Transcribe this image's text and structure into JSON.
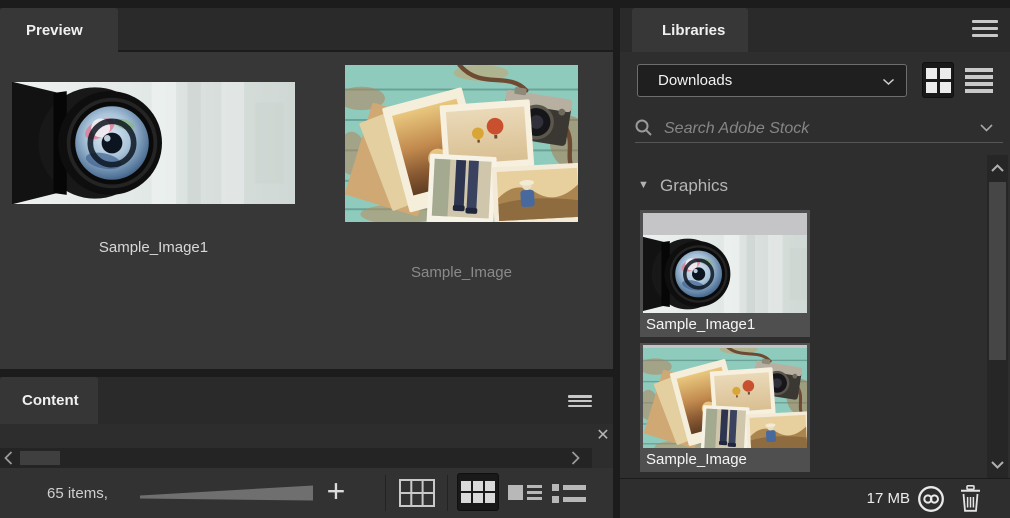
{
  "colors": {
    "canvas_bg": "#1c1c1c",
    "panel_bg": "#373737",
    "libraries_bg": "#2e2e2e",
    "tab_strip_bg": "#2a2a2a",
    "toolbar_bg": "#323232",
    "card_bg": "#4f4f4f",
    "selected_button_bg": "#191919",
    "text_primary": "#f0f0f0",
    "text_muted": "#8a8a8a"
  },
  "preview_panel": {
    "tab_label": "Preview",
    "items": [
      {
        "label": "Sample_Image1",
        "image": "camera-lens-photo"
      },
      {
        "label": "Sample_Image",
        "image": "vintage-photo-collage"
      }
    ]
  },
  "content_panel": {
    "tab_label": "Content",
    "items_count": "65 items,"
  },
  "libraries_panel": {
    "tab_label": "Libraries",
    "folder_dropdown_value": "Downloads",
    "search_placeholder": "Search Adobe Stock",
    "section_label": "Graphics",
    "items": [
      {
        "label": "Sample_Image1",
        "image": "camera-lens-photo"
      },
      {
        "label": "Sample_Image",
        "image": "vintage-photo-collage"
      }
    ],
    "storage_size": "17 MB"
  },
  "icons": {
    "collapse_triangle": "▼",
    "close": "✕",
    "plus": "+"
  }
}
